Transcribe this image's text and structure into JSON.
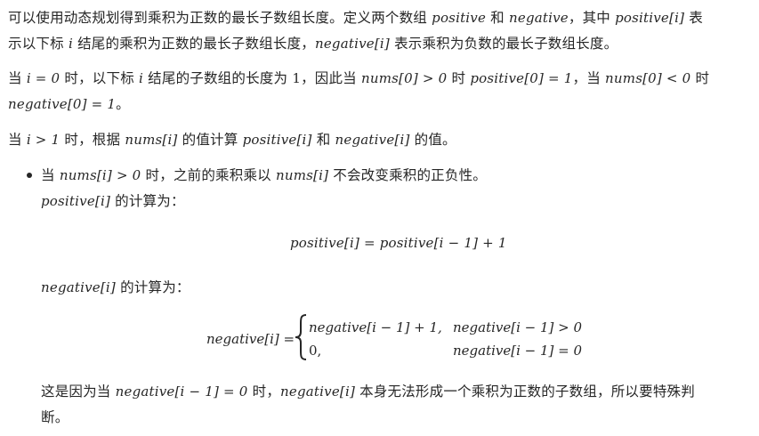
{
  "paragraph1": {
    "line1": {
      "t1": "可以使用动态规划得到乘积为正数的最长子数组长度。定义两个数组 ",
      "positive": "positive",
      "t2": " 和 ",
      "negative": "negative",
      "t3": "，其中 ",
      "positive_i": "positive[i]",
      "t4": " 表"
    },
    "line2": {
      "t1": "示以下标 ",
      "i": "i",
      "t2": " 结尾的乘积为正数的最长子数组长度，",
      "negative_i": "negative[i]",
      "t3": " 表示乘积为负数的最长子数组长度。"
    }
  },
  "paragraph2": {
    "line1": {
      "t1": "当 ",
      "eq_i0": "i = 0",
      "t2": " 时，以下标 ",
      "i": "i",
      "t3": " 结尾的子数组的长度为 ",
      "one": "1",
      "t4": "，因此当 ",
      "nums0_gt": "nums[0] > 0",
      "t5": " 时 ",
      "pos0_eq": "positive[0] = 1",
      "t6": "，当 ",
      "nums0_lt": "nums[0] < 0",
      "t7": " 时"
    },
    "line2": {
      "neg0_eq": "negative[0] = 1",
      "t1": "。"
    }
  },
  "paragraph3": {
    "t1": "当 ",
    "i_gt_1": "i > 1",
    "t2": " 时，根据 ",
    "nums_i": "nums[i]",
    "t3": " 的值计算 ",
    "positive_i": "positive[i]",
    "t4": " 和 ",
    "negative_i": "negative[i]",
    "t5": " 的值。"
  },
  "bullet": {
    "line1": {
      "t1": "当 ",
      "nums_i_gt": "nums[i] > 0",
      "t2": " 时，之前的乘积乘以 ",
      "nums_i": "nums[i]",
      "t3": " 不会改变乘积的正负性。"
    },
    "line2": {
      "positive_i": "positive[i]",
      "t1": " 的计算为："
    },
    "formula1": "positive[i] = positive[i − 1] + 1",
    "line3": {
      "negative_i": "negative[i]",
      "t1": " 的计算为："
    },
    "formula2": {
      "lhs": "negative[i] =",
      "case1_expr": "negative[i − 1] + 1,",
      "case1_cond": "negative[i − 1] > 0",
      "case2_expr": "0,",
      "case2_cond": "negative[i − 1] = 0"
    },
    "line4": {
      "t1": "这是因为当 ",
      "neg_eq0": "negative[i − 1] = 0",
      "t2": " 时，",
      "negative_i": "negative[i]",
      "t3": " 本身无法形成一个乘积为正数的子数组，所以要特殊判"
    },
    "line5": {
      "t1": "断。"
    }
  }
}
